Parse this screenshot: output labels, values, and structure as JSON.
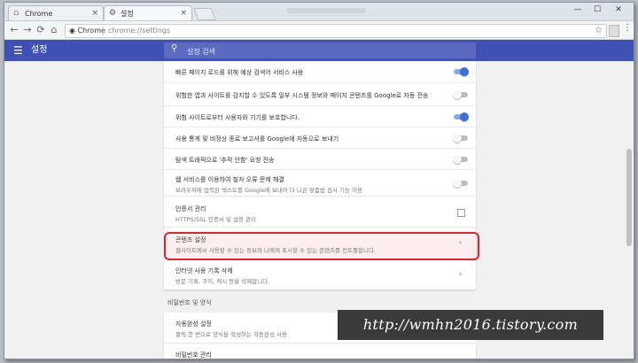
{
  "tabs": [
    {
      "label": "Chrome",
      "close": "×",
      "favicon": "page-icon"
    },
    {
      "label": "설정",
      "close": "×",
      "favicon": "gear-icon"
    }
  ],
  "window_title_blurred": "",
  "window_controls": {
    "minimize": "—",
    "maximize": "☐",
    "close": "✕"
  },
  "nav": {
    "back": "←",
    "forward": "→",
    "reload": "⟳",
    "home": "⌂"
  },
  "omnibox": {
    "site": "◉ Chrome",
    "url": "chrome://settings",
    "star": "☆"
  },
  "menu_icon": "⋮",
  "header": {
    "menu_icon": "☰",
    "title": "설정",
    "search_icon": "⚲",
    "search_placeholder": "설정 검색"
  },
  "rows": [
    {
      "title": "빠른 페이지 로드를 위해 예상 검색어 서비스 사용",
      "toggle": "on"
    },
    {
      "title": "위험한 앱과 사이트를 감지할 수 있도록 일부 시스템 정보와 페이지 콘텐츠를 Google로 자동 전송",
      "toggle": "off"
    },
    {
      "title": "위험 사이트로부터 사용자와 기기를 보호합니다.",
      "toggle": "on"
    },
    {
      "title": "사용 통계 및 비정상 종료 보고서를 Google에 자동으로 보내기",
      "toggle": "off"
    },
    {
      "title": "탐색 트래픽으로 '추적 안함' 요청 전송",
      "toggle": "off"
    },
    {
      "title": "웹 서비스를 이용하여 철자 오류 문제 해결",
      "subtitle": "브라우저에 입력된 텍스트를 Google에 보내어 더 나은 맞춤법 검사 기능 이용",
      "toggle": "off"
    },
    {
      "title": "인증서 관리",
      "subtitle": "HTTPS/SSL 인증서 및 설정 관리",
      "action": "external-link"
    },
    {
      "title": "콘텐츠 설정",
      "subtitle": "웹사이트에서 사용할 수 있는 정보와 나에게 표시할 수 있는 콘텐츠를 컨트롤합니다.",
      "action": "chevron"
    },
    {
      "title": "인터넷 사용 기록 삭제",
      "subtitle": "방문 기록, 쿠키, 캐시 등을 삭제합니다.",
      "action": "chevron"
    }
  ],
  "section2": {
    "label": "비밀번호 및 양식"
  },
  "rows2": [
    {
      "title": "자동완성 설정",
      "subtitle": "클릭 한 번으로 양식을 작성하는 자동완성 사용"
    },
    {
      "title": "비밀번호 관리"
    }
  ],
  "chevron": "›",
  "watermark": "http://wmhn2016.tistory.com",
  "colors": {
    "header": "#3f51b5",
    "toggle_on": "#3f6fd8",
    "highlight": "#d8262e"
  }
}
